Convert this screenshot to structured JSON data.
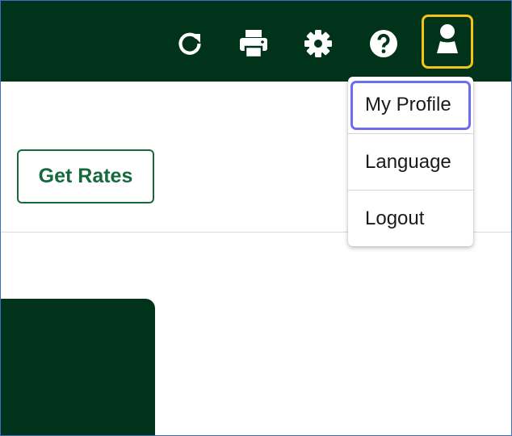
{
  "header": {
    "icons": [
      {
        "name": "refresh-icon"
      },
      {
        "name": "print-icon"
      },
      {
        "name": "settings-icon"
      },
      {
        "name": "help-icon"
      },
      {
        "name": "user-icon"
      }
    ],
    "colors": {
      "bar": "#00331a",
      "profile_highlight": "#f2c318"
    }
  },
  "actions": {
    "get_rates_label": "Get Rates"
  },
  "user_menu": {
    "items": [
      {
        "label": "My Profile",
        "focused": true
      },
      {
        "label": "Language",
        "focused": false
      },
      {
        "label": "Logout",
        "focused": false
      }
    ],
    "focus_color": "#6b6cf0"
  }
}
